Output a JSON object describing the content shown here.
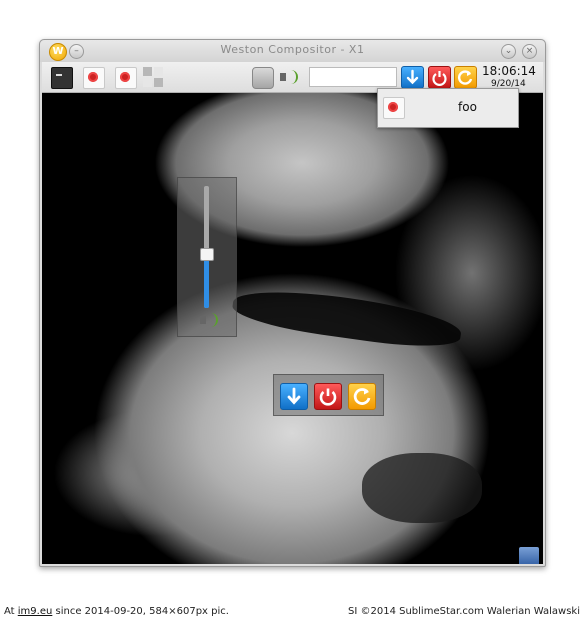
{
  "window": {
    "title": "Weston Compositor - X1",
    "logo_letter": "W",
    "minimize_glyph": "–",
    "maximize_glyph": "⌄",
    "close_glyph": "×"
  },
  "panel": {
    "launchers": [
      {
        "icon": "terminal-icon"
      },
      {
        "icon": "no-entry-icon"
      },
      {
        "icon": "no-entry-icon"
      },
      {
        "icon": "workspace-grid-icon"
      },
      {
        "icon": "drive-icon"
      },
      {
        "icon": "speaker-icon"
      }
    ],
    "entry_value": "",
    "clock_time": "18:06:14",
    "clock_date": "9/20/14"
  },
  "popups": {
    "volume": {
      "level": 0.45
    },
    "power": {
      "buttons": [
        "download-icon",
        "power-icon",
        "restart-icon"
      ]
    }
  },
  "tooltip": {
    "label": "foo"
  },
  "footer": {
    "left_prefix": "At ",
    "left_link": "im9.eu",
    "left_suffix": " since 2014-09-20, 584×607px pic.",
    "right": "SI ©2014 SublimeStar.com Walerian Walawski"
  },
  "colors": {
    "accent_blue": "#1f8ce0",
    "accent_red": "#d22222",
    "accent_orange": "#f5a623"
  }
}
